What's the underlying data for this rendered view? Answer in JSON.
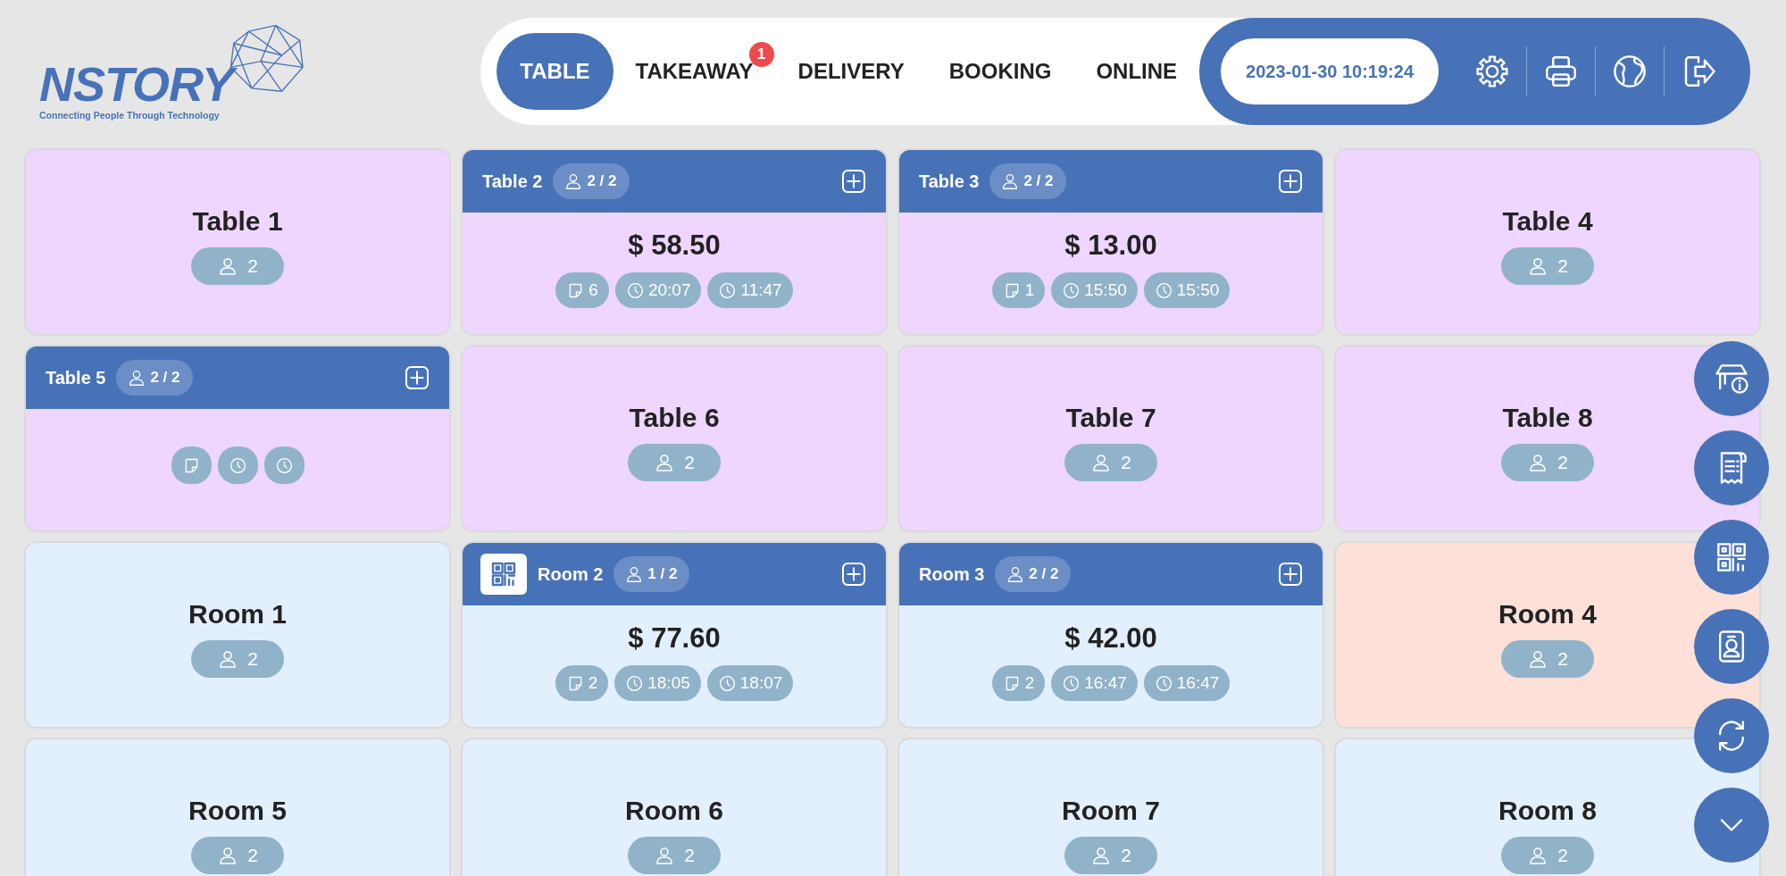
{
  "logo": {
    "name": "NSTORY",
    "tagline": "Connecting People Through Technology"
  },
  "tabs": [
    {
      "label": "TABLE",
      "selected": true
    },
    {
      "label": "TAKEAWAY",
      "selected": false,
      "badge": "1"
    },
    {
      "label": "DELIVERY",
      "selected": false
    },
    {
      "label": "BOOKING",
      "selected": false
    },
    {
      "label": "ONLINE",
      "selected": false
    }
  ],
  "datetime": "2023-01-30 10:19:24",
  "cards": [
    {
      "kind": "free",
      "name": "Table 1",
      "guests": "2",
      "color": "#eed6fe"
    },
    {
      "kind": "occupied",
      "name": "Table 2",
      "guests": "2 / 2",
      "qr_code": false,
      "amount": "$ 58.50",
      "color": "#eed6fe",
      "badges": [
        {
          "kind": "notes",
          "text": "6"
        },
        {
          "kind": "start",
          "text": "20:07"
        },
        {
          "kind": "time",
          "text": "11:47"
        }
      ]
    },
    {
      "kind": "occupied",
      "name": "Table 3",
      "guests": "2 / 2",
      "qr_code": false,
      "amount": "$ 13.00",
      "color": "#eed6fe",
      "badges": [
        {
          "kind": "notes",
          "text": "1"
        },
        {
          "kind": "start",
          "text": "15:50"
        },
        {
          "kind": "time",
          "text": "15:50"
        }
      ]
    },
    {
      "kind": "free",
      "name": "Table 4",
      "guests": "2",
      "color": "#eed6fe"
    },
    {
      "kind": "occupied",
      "name": "Table 5",
      "guests": "2 / 2",
      "qr_code": false,
      "color": "#eed6fe",
      "badges": [
        {
          "kind": "notes"
        },
        {
          "kind": "start"
        },
        {
          "kind": "time"
        }
      ]
    },
    {
      "kind": "free",
      "name": "Table 6",
      "guests": "2",
      "color": "#eed6fe"
    },
    {
      "kind": "free",
      "name": "Table 7",
      "guests": "2",
      "color": "#eed6fe"
    },
    {
      "kind": "free",
      "name": "Table 8",
      "guests": "2",
      "color": "#eed6fe"
    },
    {
      "kind": "free",
      "name": "Room 1",
      "guests": "2",
      "color": "#e2effd"
    },
    {
      "kind": "occupied",
      "name": "Room 2",
      "guests": "1 / 2",
      "qr_code": true,
      "amount": "$ 77.60",
      "color": "#e2effd",
      "badges": [
        {
          "kind": "notes",
          "text": "2"
        },
        {
          "kind": "start",
          "text": "18:05"
        },
        {
          "kind": "time",
          "text": "18:07"
        }
      ]
    },
    {
      "kind": "occupied",
      "name": "Room 3",
      "guests": "2 / 2",
      "qr_code": false,
      "amount": "$ 42.00",
      "color": "#e2effd",
      "badges": [
        {
          "kind": "notes",
          "text": "2"
        },
        {
          "kind": "start",
          "text": "16:47"
        },
        {
          "kind": "time",
          "text": "16:47"
        }
      ]
    },
    {
      "kind": "free",
      "name": "Room 4",
      "guests": "2",
      "color": "#fde0d8"
    },
    {
      "kind": "free",
      "name": "Room 5",
      "guests": "2",
      "color": "#e2effd"
    },
    {
      "kind": "free",
      "name": "Room 6",
      "guests": "2",
      "color": "#e2effd"
    },
    {
      "kind": "free",
      "name": "Room 7",
      "guests": "2",
      "color": "#e2effd"
    },
    {
      "kind": "free",
      "name": "Room 8",
      "guests": "2",
      "color": "#e2effd"
    }
  ]
}
